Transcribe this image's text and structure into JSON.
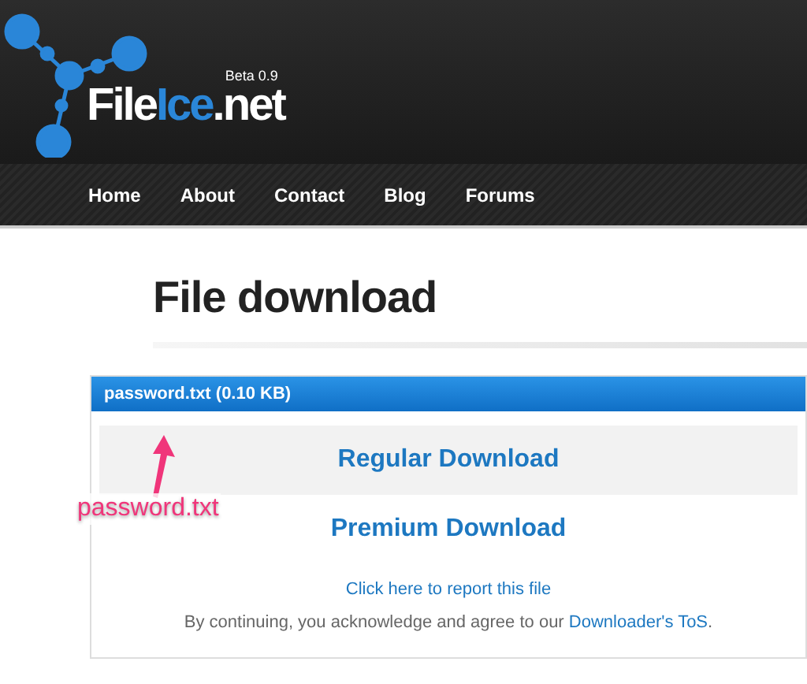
{
  "header": {
    "logo": [
      {
        "text": "File",
        "kind": "plain"
      },
      {
        "text": "Ice",
        "kind": "accent"
      },
      {
        "text": ".net",
        "kind": "plain"
      }
    ],
    "badge": "Beta 0.9"
  },
  "nav": {
    "items": [
      {
        "label": "Home"
      },
      {
        "label": "About"
      },
      {
        "label": "Contact"
      },
      {
        "label": "Blog"
      },
      {
        "label": "Forums"
      }
    ]
  },
  "page_title": "File download",
  "file_bar": {
    "title": "password.txt (0.10 KB)"
  },
  "options": [
    {
      "label": "Regular Download",
      "kind": "shaded"
    },
    {
      "label": "Premium Download",
      "kind": "plain"
    }
  ],
  "report_link": "Click here to report this file",
  "terms": {
    "text": "By continuing, you acknowledge and agree to our ",
    "link": "Downloader's ToS",
    "end": "."
  },
  "annotation": {
    "label": "password.txt"
  }
}
